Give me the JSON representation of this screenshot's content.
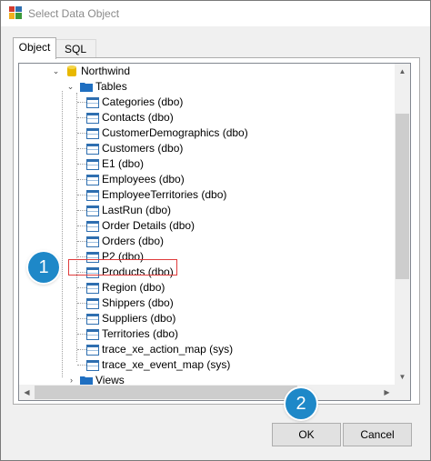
{
  "window": {
    "title": "Select Data Object"
  },
  "tabs": [
    {
      "label": "Object",
      "active": true
    },
    {
      "label": "SQL",
      "active": false
    }
  ],
  "tree": {
    "database": "Northwind",
    "tables_folder": "Tables",
    "tables": [
      "Categories (dbo)",
      "Contacts (dbo)",
      "CustomerDemographics (dbo)",
      "Customers (dbo)",
      "E1 (dbo)",
      "Employees (dbo)",
      "EmployeeTerritories (dbo)",
      "LastRun (dbo)",
      "Order Details (dbo)",
      "Orders (dbo)",
      "P2 (dbo)",
      "Products (dbo)",
      "Region (dbo)",
      "Shippers (dbo)",
      "Suppliers (dbo)",
      "Territories (dbo)",
      "trace_xe_action_map (sys)",
      "trace_xe_event_map (sys)"
    ],
    "views_folder": "Views",
    "selected_table": "Products (dbo)"
  },
  "buttons": {
    "ok": "OK",
    "cancel": "Cancel"
  },
  "callouts": {
    "step1": "1",
    "step2": "2"
  },
  "colors": {
    "callout": "#1e88c8",
    "highlight_border": "#e03c3c",
    "folder": "#1f6fc1",
    "database": "#e8b800"
  }
}
